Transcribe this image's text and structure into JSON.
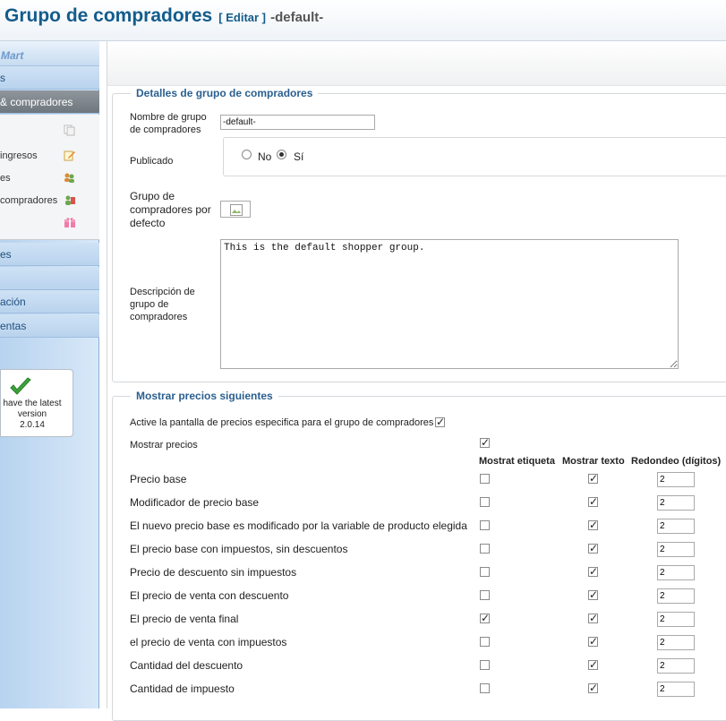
{
  "header": {
    "title": "Grupo de compradores",
    "edit_link": "[ Editar ]",
    "record_name": "-default-"
  },
  "sidebar": {
    "logo": "Mart",
    "items": [
      {
        "label": "s",
        "active": false
      },
      {
        "label": "& compradores",
        "active": true
      },
      {
        "label": "es",
        "active": false
      },
      {
        "label": "",
        "active": false
      },
      {
        "label": "ación",
        "active": false
      },
      {
        "label": "entas",
        "active": false
      }
    ],
    "submenu": [
      {
        "label": "",
        "icon": "copy-icon"
      },
      {
        "label": "ingresos",
        "icon": "edit-note-icon"
      },
      {
        "label": "es",
        "icon": "users-icon"
      },
      {
        "label": "compradores",
        "icon": "shopper-group-icon"
      },
      {
        "label": "",
        "icon": "gift-icon"
      }
    ],
    "version_box": {
      "line1": "have the latest",
      "line2": "version",
      "line3": "2.0.14"
    }
  },
  "details": {
    "legend": "Detalles de grupo de compradores",
    "name_label": "Nombre de grupo de compradores",
    "name_value": "-default-",
    "published_label": "Publicado",
    "radio_no": "No",
    "radio_yes": "Sí",
    "published": "Sí",
    "default_label": "Grupo de compradores por defecto",
    "description_label": "Descripción de grupo de compradores",
    "description_value": "This is the default shopper group."
  },
  "prices": {
    "legend": "Mostrar precios siguientes",
    "activate_label": "Active la pantalla de precios especifica para el grupo de compradores",
    "activate_checked": true,
    "show_prices_label": "Mostrar precios",
    "show_prices_checked": true,
    "columns": [
      "Mostrat etiqueta",
      "Mostrar texto",
      "Redondeo (dígitos)"
    ],
    "rows": [
      {
        "label": "Precio base",
        "show_label": false,
        "show_text": true,
        "rounding": "2"
      },
      {
        "label": "Modificador de precio base",
        "show_label": false,
        "show_text": true,
        "rounding": "2"
      },
      {
        "label": "El nuevo precio base es modificado por la variable de producto elegida",
        "show_label": false,
        "show_text": true,
        "rounding": "2"
      },
      {
        "label": "El precio base con impuestos, sin descuentos",
        "show_label": false,
        "show_text": true,
        "rounding": "2"
      },
      {
        "label": "Precio de descuento sin impuestos",
        "show_label": false,
        "show_text": true,
        "rounding": "2"
      },
      {
        "label": "El precio de venta con descuento",
        "show_label": false,
        "show_text": true,
        "rounding": "2"
      },
      {
        "label": "El precio de venta final",
        "show_label": true,
        "show_text": true,
        "rounding": "2"
      },
      {
        "label": "el precio de venta con impuestos",
        "show_label": false,
        "show_text": true,
        "rounding": "2"
      },
      {
        "label": "Cantidad del descuento",
        "show_label": false,
        "show_text": true,
        "rounding": "2"
      },
      {
        "label": "Cantidad de impuesto",
        "show_label": false,
        "show_text": true,
        "rounding": "2"
      }
    ]
  }
}
